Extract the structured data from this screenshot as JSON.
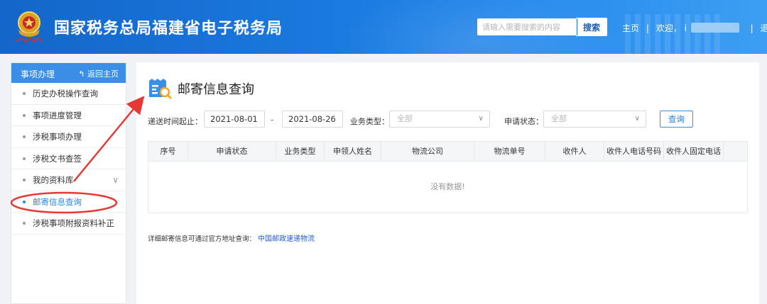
{
  "header": {
    "title": "国家税务总局福建省电子税务局",
    "search_placeholder": "请输入需要搜索的内容",
    "search_button": "搜索",
    "home_link": "主页",
    "welcome": "欢迎，",
    "welcome_initial": "i",
    "logout": "退出"
  },
  "sidebar": {
    "title": "事项办理",
    "back_label": "返回主页",
    "items": [
      {
        "label": "历史办税操作查询"
      },
      {
        "label": "事项进度管理"
      },
      {
        "label": "涉税事项办理"
      },
      {
        "label": "涉税文书查签"
      },
      {
        "label": "我的资料库",
        "expandable": true
      },
      {
        "label": "邮寄信息查询",
        "active": true
      },
      {
        "label": "涉税事项附报资料补正"
      }
    ]
  },
  "main": {
    "title": "邮寄信息查询",
    "filters": {
      "date_label": "递送时间起止：",
      "date_start": "2021-08-01",
      "date_sep": "-",
      "date_end": "2021-08-26",
      "biz_type_label": "业务类型：",
      "biz_type_value": "全部",
      "status_label": "申请状态：",
      "status_value": "全部",
      "query_button": "查询"
    },
    "table": {
      "columns": [
        "序号",
        "申请状态",
        "业务类型",
        "申领人姓名",
        "物流公司",
        "物流单号",
        "收件人",
        "收件人电话号码",
        "收件人固定电话"
      ],
      "empty_text": "没有数据!"
    },
    "note": {
      "text": "详细邮寄信息可通过官方地址查询：",
      "link": "中国邮政速递物流"
    }
  },
  "colors": {
    "header_blue": "#1a7ae0",
    "sidebar_head": "#3a8ee6",
    "active_item": "#1e88e5",
    "annotation_red": "#e53935"
  }
}
